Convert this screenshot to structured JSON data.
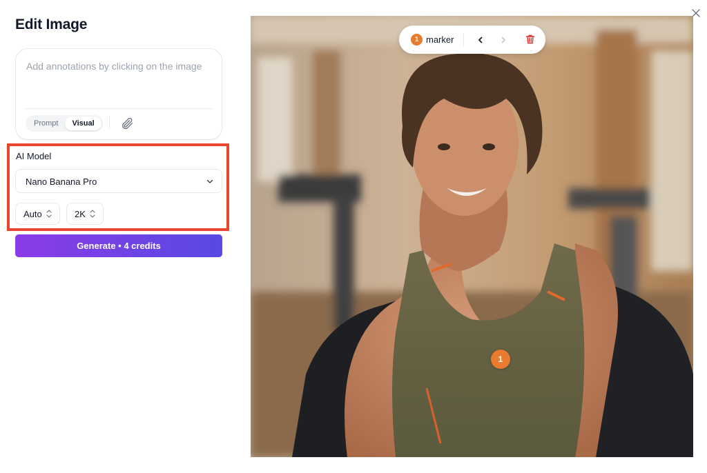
{
  "panel": {
    "title": "Edit Image",
    "prompt_placeholder": "Add annotations by clicking on the image",
    "mode_prompt": "Prompt",
    "mode_visual": "Visual",
    "model_label": "AI Model",
    "model_value": "Nano Banana Pro",
    "aspect_value": "Auto",
    "resolution_value": "2K",
    "generate_label": "Generate • 4 credits"
  },
  "toolbar": {
    "marker_count": "1",
    "marker_label": "marker"
  },
  "annotation": {
    "pin_number": "1"
  },
  "colors": {
    "accent_orange": "#ea7a2e",
    "highlight_red": "#e8452c",
    "gradient_start": "#8b3be8",
    "gradient_end": "#5849e2"
  },
  "icons": [
    "attach-icon",
    "chevron-down-icon",
    "stepper-icon",
    "chevron-left-icon",
    "chevron-right-icon",
    "trash-icon",
    "close-icon"
  ]
}
